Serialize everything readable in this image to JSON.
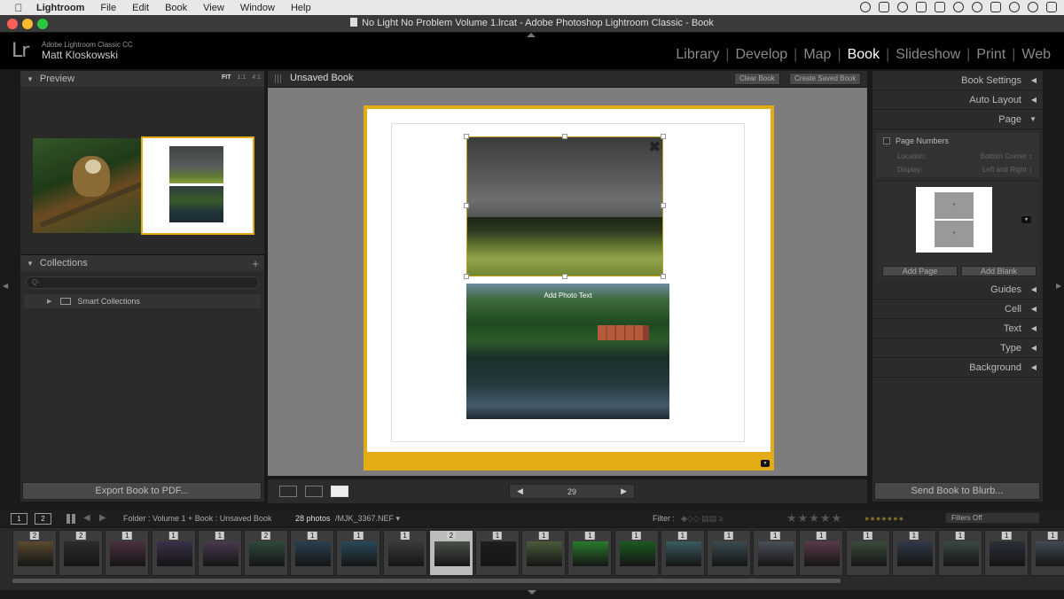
{
  "menubar": {
    "app_name": "Lightroom",
    "items": [
      "File",
      "Edit",
      "Book",
      "View",
      "Window",
      "Help"
    ]
  },
  "window": {
    "title": "No Light No Problem Volume 1.lrcat - Adobe Photoshop Lightroom Classic - Book"
  },
  "identity": {
    "logo": "Lr",
    "product": "Adobe Lightroom Classic CC",
    "user": "Matt Kloskowski"
  },
  "modules": [
    "Library",
    "Develop",
    "Map",
    "Book",
    "Slideshow",
    "Print",
    "Web"
  ],
  "active_module": "Book",
  "left_panel": {
    "preview_title": "Preview",
    "preview_options": [
      "FIT",
      "1:1",
      "4:1"
    ],
    "collections_title": "Collections",
    "search_placeholder": "Q-",
    "smart_collections": "Smart Collections",
    "export_button": "Export Book to PDF..."
  },
  "center": {
    "book_title": "Unsaved Book",
    "clear_book": "Clear Book",
    "create_saved_book": "Create Saved Book",
    "photo_caption": "Add Photo Text",
    "page_number": "29"
  },
  "right_panel": {
    "book_settings": "Book Settings",
    "auto_layout": "Auto Layout",
    "page": "Page",
    "page_numbers_label": "Page Numbers",
    "page_numbers_checked": false,
    "location_label": "Location:",
    "location_value": "Bottom Corner ↕",
    "display_label": "Display:",
    "display_value": "Left and Right ↕",
    "add_page": "Add Page",
    "add_blank": "Add Blank",
    "sections": [
      "Guides",
      "Cell",
      "Text",
      "Type",
      "Background"
    ],
    "send_button": "Send Book to Blurb..."
  },
  "filmstrip_toolbar": {
    "monitor1": "1",
    "monitor2": "2",
    "path": "Folder : Volume 1  +  Book : Unsaved Book",
    "count": "28 photos",
    "file": "/MJK_3367.NEF ▾",
    "filter_label": "Filter :",
    "filter_value": "Filters Off"
  },
  "filmstrip": {
    "badges": [
      "2",
      "2",
      "1",
      "1",
      "1",
      "2",
      "1",
      "1",
      "1",
      "2",
      "1",
      "1",
      "1",
      "1",
      "1",
      "1",
      "1",
      "1",
      "1",
      "1",
      "1",
      "1",
      "1"
    ],
    "selected_index": 9
  },
  "colors": {
    "accent": "#e3ac16",
    "background": "#1a1a1a",
    "panel": "#2b2b2b"
  }
}
